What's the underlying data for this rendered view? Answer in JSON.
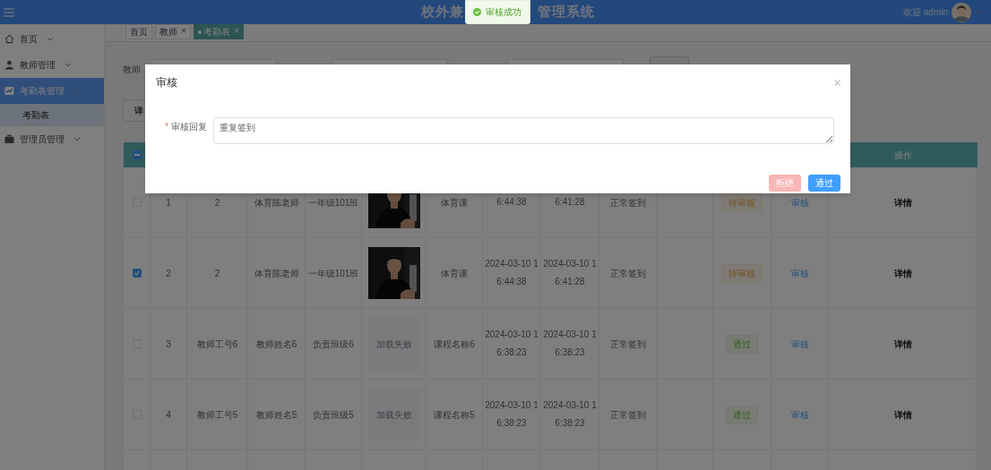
{
  "header": {
    "title_parts": [
      "校外兼",
      "管理系统"
    ],
    "welcome": "欢迎 admin"
  },
  "toast": {
    "kind": "success",
    "message": "审核成功"
  },
  "sidebar": {
    "items": [
      {
        "label": "首页",
        "expanded": false,
        "selected": false
      },
      {
        "label": "教师管理",
        "expanded": false,
        "selected": false
      },
      {
        "label": "考勤表管理",
        "expanded": true,
        "selected": true,
        "children": [
          {
            "label": "考勤表",
            "selected": true
          }
        ]
      },
      {
        "label": "管理员管理",
        "expanded": false,
        "selected": false
      }
    ]
  },
  "tabs": [
    {
      "label": "首页",
      "closable": false,
      "selected": false
    },
    {
      "label": "教师",
      "closable": true,
      "selected": false
    },
    {
      "label": "考勤表",
      "closable": true,
      "selected": true
    }
  ],
  "filter": {
    "label": "教师"
  },
  "toolbar": {
    "button": "详"
  },
  "table": {
    "header_checkbox": {
      "indeterminate": true
    },
    "action_header": "操作",
    "rows": [
      {
        "checked": false,
        "index": "1",
        "teacher_no": "2",
        "teacher_name": "体育陈老师",
        "class": "一年级101班",
        "course": "体育课",
        "time_1": "6:44:38",
        "time_2": "6:41:28",
        "sign_type": "正常签到",
        "status": {
          "kind": "pending",
          "label": "待审核"
        },
        "review_link": "审核",
        "detail": "详情"
      },
      {
        "checked": true,
        "index": "2",
        "teacher_no": "2",
        "teacher_name": "体育陈老师",
        "class": "一年级101班",
        "course": "体育课",
        "time_1": "2024-03-10 16:44:38",
        "time_2": "2024-03-10 16:41:28",
        "sign_type": "正常签到",
        "status": {
          "kind": "pending",
          "label": "待审核"
        },
        "review_link": "审核",
        "detail": "详情"
      },
      {
        "checked": false,
        "index": "3",
        "teacher_no": "教师工号6",
        "teacher_name": "教师姓名6",
        "class": "负责班级6",
        "photo": {
          "kind": "failed",
          "label": "加载失败"
        },
        "course": "课程名称6",
        "time_1": "2024-03-10 16:38:23",
        "time_2": "2024-03-10 16:38:23",
        "sign_type": "正常签到",
        "status": {
          "kind": "approved",
          "label": "通过"
        },
        "review_link": "审核",
        "detail": "详情"
      },
      {
        "checked": false,
        "index": "4",
        "teacher_no": "教师工号5",
        "teacher_name": "教师姓名5",
        "class": "负责班级5",
        "photo": {
          "kind": "failed",
          "label": "加载失败"
        },
        "course": "课程名称5",
        "time_1": "2024-03-10 16:38:23",
        "time_2": "2024-03-10 16:38:23",
        "sign_type": "正常签到",
        "status": {
          "kind": "approved",
          "label": "通过"
        },
        "review_link": "审核",
        "detail": "详情"
      }
    ]
  },
  "dialog": {
    "title": "审核",
    "field": {
      "required_mark": "*",
      "label": "审核回复",
      "value": "重复签到"
    },
    "buttons": [
      {
        "kind": "danger",
        "label": "拒绝"
      },
      {
        "kind": "primary",
        "label": "通过"
      }
    ]
  }
}
